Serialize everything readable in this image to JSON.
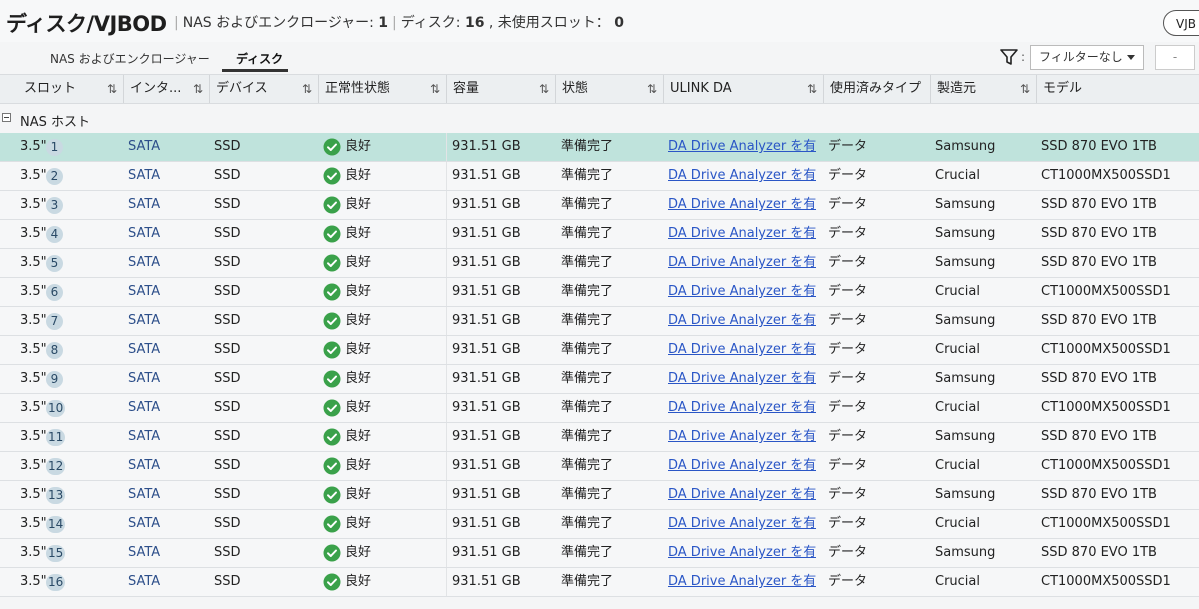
{
  "header": {
    "title": "ディスク/VJBOD",
    "meta_prefix": "NAS およびエンクロージャー: ",
    "enclosure_count": "1",
    "disk_prefix": "ディスク: ",
    "disk_count": "16",
    "slot_prefix": " , 未使用スロット： ",
    "unused_slots": "0",
    "vjbod_button": "VJB"
  },
  "tabs": [
    {
      "label": "NAS およびエンクロージャー",
      "active": false
    },
    {
      "label": "ディスク",
      "active": true
    }
  ],
  "filter": {
    "value": "フィルターなし",
    "colon": ":",
    "more": "-"
  },
  "columns": [
    {
      "label": "スロット",
      "sortable": true
    },
    {
      "label": "インタ...",
      "sortable": true
    },
    {
      "label": "デバイス",
      "sortable": true
    },
    {
      "label": "正常性状態",
      "sortable": true
    },
    {
      "label": "容量",
      "sortable": true
    },
    {
      "label": "状態",
      "sortable": true
    },
    {
      "label": "ULINK DA",
      "sortable": true
    },
    {
      "label": "使用済みタイプ",
      "sortable": false
    },
    {
      "label": "製造元",
      "sortable": true
    },
    {
      "label": "モデル",
      "sortable": false
    }
  ],
  "sort_glyph": "⇅",
  "group": {
    "label": "NAS ホスト"
  },
  "rows": [
    {
      "slot_type": "3.5\"",
      "slot": "1",
      "iface": "SATA",
      "device": "SSD",
      "health": "良好",
      "capacity": "931.51 GB",
      "status": "準備完了",
      "ulink": "DA Drive Analyzer を有...",
      "use_type": "データ",
      "maker": "Samsung",
      "model": "SSD 870 EVO 1TB",
      "selected": true
    },
    {
      "slot_type": "3.5\"",
      "slot": "2",
      "iface": "SATA",
      "device": "SSD",
      "health": "良好",
      "capacity": "931.51 GB",
      "status": "準備完了",
      "ulink": "DA Drive Analyzer を有...",
      "use_type": "データ",
      "maker": "Crucial",
      "model": "CT1000MX500SSD1"
    },
    {
      "slot_type": "3.5\"",
      "slot": "3",
      "iface": "SATA",
      "device": "SSD",
      "health": "良好",
      "capacity": "931.51 GB",
      "status": "準備完了",
      "ulink": "DA Drive Analyzer を有...",
      "use_type": "データ",
      "maker": "Samsung",
      "model": "SSD 870 EVO 1TB"
    },
    {
      "slot_type": "3.5\"",
      "slot": "4",
      "iface": "SATA",
      "device": "SSD",
      "health": "良好",
      "capacity": "931.51 GB",
      "status": "準備完了",
      "ulink": "DA Drive Analyzer を有...",
      "use_type": "データ",
      "maker": "Samsung",
      "model": "SSD 870 EVO 1TB"
    },
    {
      "slot_type": "3.5\"",
      "slot": "5",
      "iface": "SATA",
      "device": "SSD",
      "health": "良好",
      "capacity": "931.51 GB",
      "status": "準備完了",
      "ulink": "DA Drive Analyzer を有...",
      "use_type": "データ",
      "maker": "Samsung",
      "model": "SSD 870 EVO 1TB"
    },
    {
      "slot_type": "3.5\"",
      "slot": "6",
      "iface": "SATA",
      "device": "SSD",
      "health": "良好",
      "capacity": "931.51 GB",
      "status": "準備完了",
      "ulink": "DA Drive Analyzer を有...",
      "use_type": "データ",
      "maker": "Crucial",
      "model": "CT1000MX500SSD1"
    },
    {
      "slot_type": "3.5\"",
      "slot": "7",
      "iface": "SATA",
      "device": "SSD",
      "health": "良好",
      "capacity": "931.51 GB",
      "status": "準備完了",
      "ulink": "DA Drive Analyzer を有...",
      "use_type": "データ",
      "maker": "Samsung",
      "model": "SSD 870 EVO 1TB"
    },
    {
      "slot_type": "3.5\"",
      "slot": "8",
      "iface": "SATA",
      "device": "SSD",
      "health": "良好",
      "capacity": "931.51 GB",
      "status": "準備完了",
      "ulink": "DA Drive Analyzer を有...",
      "use_type": "データ",
      "maker": "Crucial",
      "model": "CT1000MX500SSD1"
    },
    {
      "slot_type": "3.5\"",
      "slot": "9",
      "iface": "SATA",
      "device": "SSD",
      "health": "良好",
      "capacity": "931.51 GB",
      "status": "準備完了",
      "ulink": "DA Drive Analyzer を有...",
      "use_type": "データ",
      "maker": "Samsung",
      "model": "SSD 870 EVO 1TB"
    },
    {
      "slot_type": "3.5\"",
      "slot": "10",
      "iface": "SATA",
      "device": "SSD",
      "health": "良好",
      "capacity": "931.51 GB",
      "status": "準備完了",
      "ulink": "DA Drive Analyzer を有...",
      "use_type": "データ",
      "maker": "Crucial",
      "model": "CT1000MX500SSD1"
    },
    {
      "slot_type": "3.5\"",
      "slot": "11",
      "iface": "SATA",
      "device": "SSD",
      "health": "良好",
      "capacity": "931.51 GB",
      "status": "準備完了",
      "ulink": "DA Drive Analyzer を有...",
      "use_type": "データ",
      "maker": "Samsung",
      "model": "SSD 870 EVO 1TB"
    },
    {
      "slot_type": "3.5\"",
      "slot": "12",
      "iface": "SATA",
      "device": "SSD",
      "health": "良好",
      "capacity": "931.51 GB",
      "status": "準備完了",
      "ulink": "DA Drive Analyzer を有...",
      "use_type": "データ",
      "maker": "Crucial",
      "model": "CT1000MX500SSD1"
    },
    {
      "slot_type": "3.5\"",
      "slot": "13",
      "iface": "SATA",
      "device": "SSD",
      "health": "良好",
      "capacity": "931.51 GB",
      "status": "準備完了",
      "ulink": "DA Drive Analyzer を有...",
      "use_type": "データ",
      "maker": "Samsung",
      "model": "SSD 870 EVO 1TB"
    },
    {
      "slot_type": "3.5\"",
      "slot": "14",
      "iface": "SATA",
      "device": "SSD",
      "health": "良好",
      "capacity": "931.51 GB",
      "status": "準備完了",
      "ulink": "DA Drive Analyzer を有...",
      "use_type": "データ",
      "maker": "Crucial",
      "model": "CT1000MX500SSD1"
    },
    {
      "slot_type": "3.5\"",
      "slot": "15",
      "iface": "SATA",
      "device": "SSD",
      "health": "良好",
      "capacity": "931.51 GB",
      "status": "準備完了",
      "ulink": "DA Drive Analyzer を有...",
      "use_type": "データ",
      "maker": "Samsung",
      "model": "SSD 870 EVO 1TB"
    },
    {
      "slot_type": "3.5\"",
      "slot": "16",
      "iface": "SATA",
      "device": "SSD",
      "health": "良好",
      "capacity": "931.51 GB",
      "status": "準備完了",
      "ulink": "DA Drive Analyzer を有...",
      "use_type": "データ",
      "maker": "Crucial",
      "model": "CT1000MX500SSD1"
    }
  ],
  "colors": {
    "selected_row": "#bfe3dc",
    "link": "#2a56c6",
    "health_ok": "#3aa14a"
  }
}
